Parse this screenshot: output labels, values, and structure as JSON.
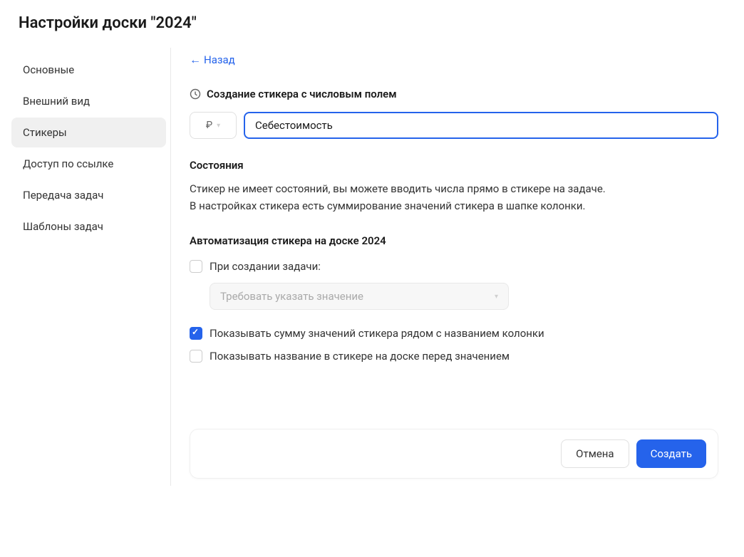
{
  "header": {
    "title": "Настройки доски \"2024\""
  },
  "sidebar": {
    "items": [
      {
        "label": "Основные",
        "active": 0
      },
      {
        "label": "Внешний вид",
        "active": 0
      },
      {
        "label": "Стикеры",
        "active": 1
      },
      {
        "label": "Доступ по ссылке",
        "active": 0
      },
      {
        "label": "Передача задач",
        "active": 0
      },
      {
        "label": "Шаблоны задач",
        "active": 0
      }
    ]
  },
  "main": {
    "back_label": "Назад",
    "section_title": "Создание стикера с числовым полем",
    "currency_symbol": "₽",
    "name_value": "Себестоимость",
    "states_title": "Состояния",
    "states_description_line1": "Стикер не имеет состояний, вы можете вводить числа прямо в стикере на задаче.",
    "states_description_line2": "В настройках стикера есть суммирование значений стикера в шапке колонки.",
    "automation_title": "Автоматизация стикера  на доске 2024",
    "checkbox_on_create": "При создании задачи:",
    "select_placeholder": "Требовать указать значение",
    "checkbox_show_sum": "Показывать сумму значений стикера рядом с названием колонки",
    "checkbox_show_name": "Показывать название в стикере на доске перед значением"
  },
  "footer": {
    "cancel_label": "Отмена",
    "create_label": "Создать"
  }
}
